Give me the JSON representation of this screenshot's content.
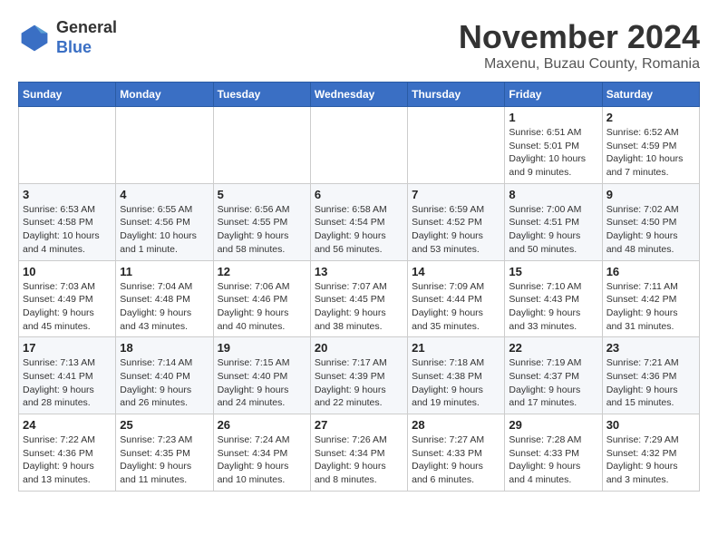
{
  "logo": {
    "line1": "General",
    "line2": "Blue"
  },
  "title": "November 2024",
  "location": "Maxenu, Buzau County, Romania",
  "days_of_week": [
    "Sunday",
    "Monday",
    "Tuesday",
    "Wednesday",
    "Thursday",
    "Friday",
    "Saturday"
  ],
  "weeks": [
    [
      null,
      null,
      null,
      null,
      null,
      {
        "day": "1",
        "sunrise": "Sunrise: 6:51 AM",
        "sunset": "Sunset: 5:01 PM",
        "daylight": "Daylight: 10 hours and 9 minutes."
      },
      {
        "day": "2",
        "sunrise": "Sunrise: 6:52 AM",
        "sunset": "Sunset: 4:59 PM",
        "daylight": "Daylight: 10 hours and 7 minutes."
      }
    ],
    [
      {
        "day": "3",
        "sunrise": "Sunrise: 6:53 AM",
        "sunset": "Sunset: 4:58 PM",
        "daylight": "Daylight: 10 hours and 4 minutes."
      },
      {
        "day": "4",
        "sunrise": "Sunrise: 6:55 AM",
        "sunset": "Sunset: 4:56 PM",
        "daylight": "Daylight: 10 hours and 1 minute."
      },
      {
        "day": "5",
        "sunrise": "Sunrise: 6:56 AM",
        "sunset": "Sunset: 4:55 PM",
        "daylight": "Daylight: 9 hours and 58 minutes."
      },
      {
        "day": "6",
        "sunrise": "Sunrise: 6:58 AM",
        "sunset": "Sunset: 4:54 PM",
        "daylight": "Daylight: 9 hours and 56 minutes."
      },
      {
        "day": "7",
        "sunrise": "Sunrise: 6:59 AM",
        "sunset": "Sunset: 4:52 PM",
        "daylight": "Daylight: 9 hours and 53 minutes."
      },
      {
        "day": "8",
        "sunrise": "Sunrise: 7:00 AM",
        "sunset": "Sunset: 4:51 PM",
        "daylight": "Daylight: 9 hours and 50 minutes."
      },
      {
        "day": "9",
        "sunrise": "Sunrise: 7:02 AM",
        "sunset": "Sunset: 4:50 PM",
        "daylight": "Daylight: 9 hours and 48 minutes."
      }
    ],
    [
      {
        "day": "10",
        "sunrise": "Sunrise: 7:03 AM",
        "sunset": "Sunset: 4:49 PM",
        "daylight": "Daylight: 9 hours and 45 minutes."
      },
      {
        "day": "11",
        "sunrise": "Sunrise: 7:04 AM",
        "sunset": "Sunset: 4:48 PM",
        "daylight": "Daylight: 9 hours and 43 minutes."
      },
      {
        "day": "12",
        "sunrise": "Sunrise: 7:06 AM",
        "sunset": "Sunset: 4:46 PM",
        "daylight": "Daylight: 9 hours and 40 minutes."
      },
      {
        "day": "13",
        "sunrise": "Sunrise: 7:07 AM",
        "sunset": "Sunset: 4:45 PM",
        "daylight": "Daylight: 9 hours and 38 minutes."
      },
      {
        "day": "14",
        "sunrise": "Sunrise: 7:09 AM",
        "sunset": "Sunset: 4:44 PM",
        "daylight": "Daylight: 9 hours and 35 minutes."
      },
      {
        "day": "15",
        "sunrise": "Sunrise: 7:10 AM",
        "sunset": "Sunset: 4:43 PM",
        "daylight": "Daylight: 9 hours and 33 minutes."
      },
      {
        "day": "16",
        "sunrise": "Sunrise: 7:11 AM",
        "sunset": "Sunset: 4:42 PM",
        "daylight": "Daylight: 9 hours and 31 minutes."
      }
    ],
    [
      {
        "day": "17",
        "sunrise": "Sunrise: 7:13 AM",
        "sunset": "Sunset: 4:41 PM",
        "daylight": "Daylight: 9 hours and 28 minutes."
      },
      {
        "day": "18",
        "sunrise": "Sunrise: 7:14 AM",
        "sunset": "Sunset: 4:40 PM",
        "daylight": "Daylight: 9 hours and 26 minutes."
      },
      {
        "day": "19",
        "sunrise": "Sunrise: 7:15 AM",
        "sunset": "Sunset: 4:40 PM",
        "daylight": "Daylight: 9 hours and 24 minutes."
      },
      {
        "day": "20",
        "sunrise": "Sunrise: 7:17 AM",
        "sunset": "Sunset: 4:39 PM",
        "daylight": "Daylight: 9 hours and 22 minutes."
      },
      {
        "day": "21",
        "sunrise": "Sunrise: 7:18 AM",
        "sunset": "Sunset: 4:38 PM",
        "daylight": "Daylight: 9 hours and 19 minutes."
      },
      {
        "day": "22",
        "sunrise": "Sunrise: 7:19 AM",
        "sunset": "Sunset: 4:37 PM",
        "daylight": "Daylight: 9 hours and 17 minutes."
      },
      {
        "day": "23",
        "sunrise": "Sunrise: 7:21 AM",
        "sunset": "Sunset: 4:36 PM",
        "daylight": "Daylight: 9 hours and 15 minutes."
      }
    ],
    [
      {
        "day": "24",
        "sunrise": "Sunrise: 7:22 AM",
        "sunset": "Sunset: 4:36 PM",
        "daylight": "Daylight: 9 hours and 13 minutes."
      },
      {
        "day": "25",
        "sunrise": "Sunrise: 7:23 AM",
        "sunset": "Sunset: 4:35 PM",
        "daylight": "Daylight: 9 hours and 11 minutes."
      },
      {
        "day": "26",
        "sunrise": "Sunrise: 7:24 AM",
        "sunset": "Sunset: 4:34 PM",
        "daylight": "Daylight: 9 hours and 10 minutes."
      },
      {
        "day": "27",
        "sunrise": "Sunrise: 7:26 AM",
        "sunset": "Sunset: 4:34 PM",
        "daylight": "Daylight: 9 hours and 8 minutes."
      },
      {
        "day": "28",
        "sunrise": "Sunrise: 7:27 AM",
        "sunset": "Sunset: 4:33 PM",
        "daylight": "Daylight: 9 hours and 6 minutes."
      },
      {
        "day": "29",
        "sunrise": "Sunrise: 7:28 AM",
        "sunset": "Sunset: 4:33 PM",
        "daylight": "Daylight: 9 hours and 4 minutes."
      },
      {
        "day": "30",
        "sunrise": "Sunrise: 7:29 AM",
        "sunset": "Sunset: 4:32 PM",
        "daylight": "Daylight: 9 hours and 3 minutes."
      }
    ]
  ]
}
